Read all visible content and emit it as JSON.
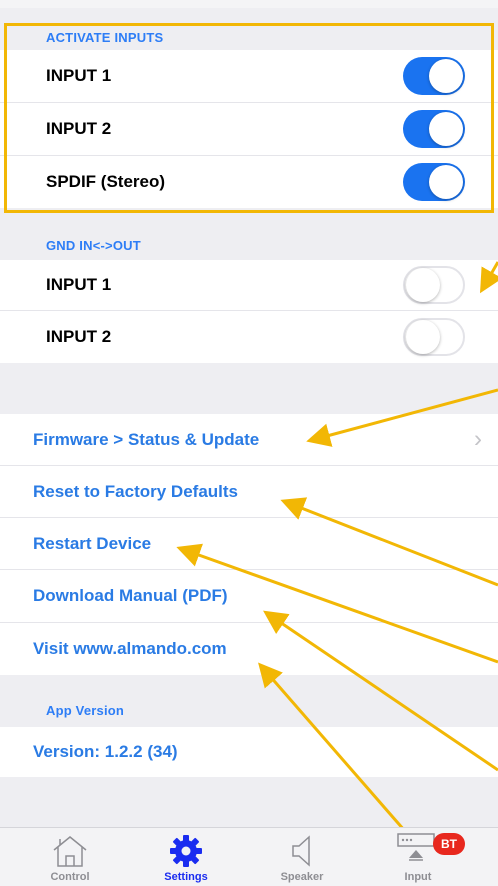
{
  "activate_inputs": {
    "header": "ACTIVATE INPUTS",
    "items": [
      {
        "label": "INPUT 1",
        "on": true
      },
      {
        "label": "INPUT 2",
        "on": true
      },
      {
        "label": "SPDIF (Stereo)",
        "on": true
      }
    ]
  },
  "gnd": {
    "header": "GND IN<->OUT",
    "items": [
      {
        "label": "INPUT 1",
        "on": false
      },
      {
        "label": "INPUT 2",
        "on": false
      }
    ]
  },
  "links": {
    "firmware": "Firmware > Status & Update",
    "firmware_chevron": "›",
    "reset": "Reset to Factory Defaults",
    "restart": "Restart Device",
    "manual": "Download Manual (PDF)",
    "visit": "Visit www.almando.com"
  },
  "app_version": {
    "header": "App Version",
    "value": "Version: 1.2.2 (34)"
  },
  "tabs": [
    {
      "label": "Control",
      "icon": "home-icon",
      "active": false
    },
    {
      "label": "Settings",
      "icon": "gear-icon",
      "active": true
    },
    {
      "label": "Speaker",
      "icon": "speaker-icon",
      "active": false
    },
    {
      "label": "Input",
      "icon": "input-icon",
      "active": false
    }
  ],
  "badge": "BT",
  "colors": {
    "accent": "#1a73f0",
    "link": "#2a7be4",
    "highlight": "#f2b705",
    "badge": "#e8281e"
  }
}
